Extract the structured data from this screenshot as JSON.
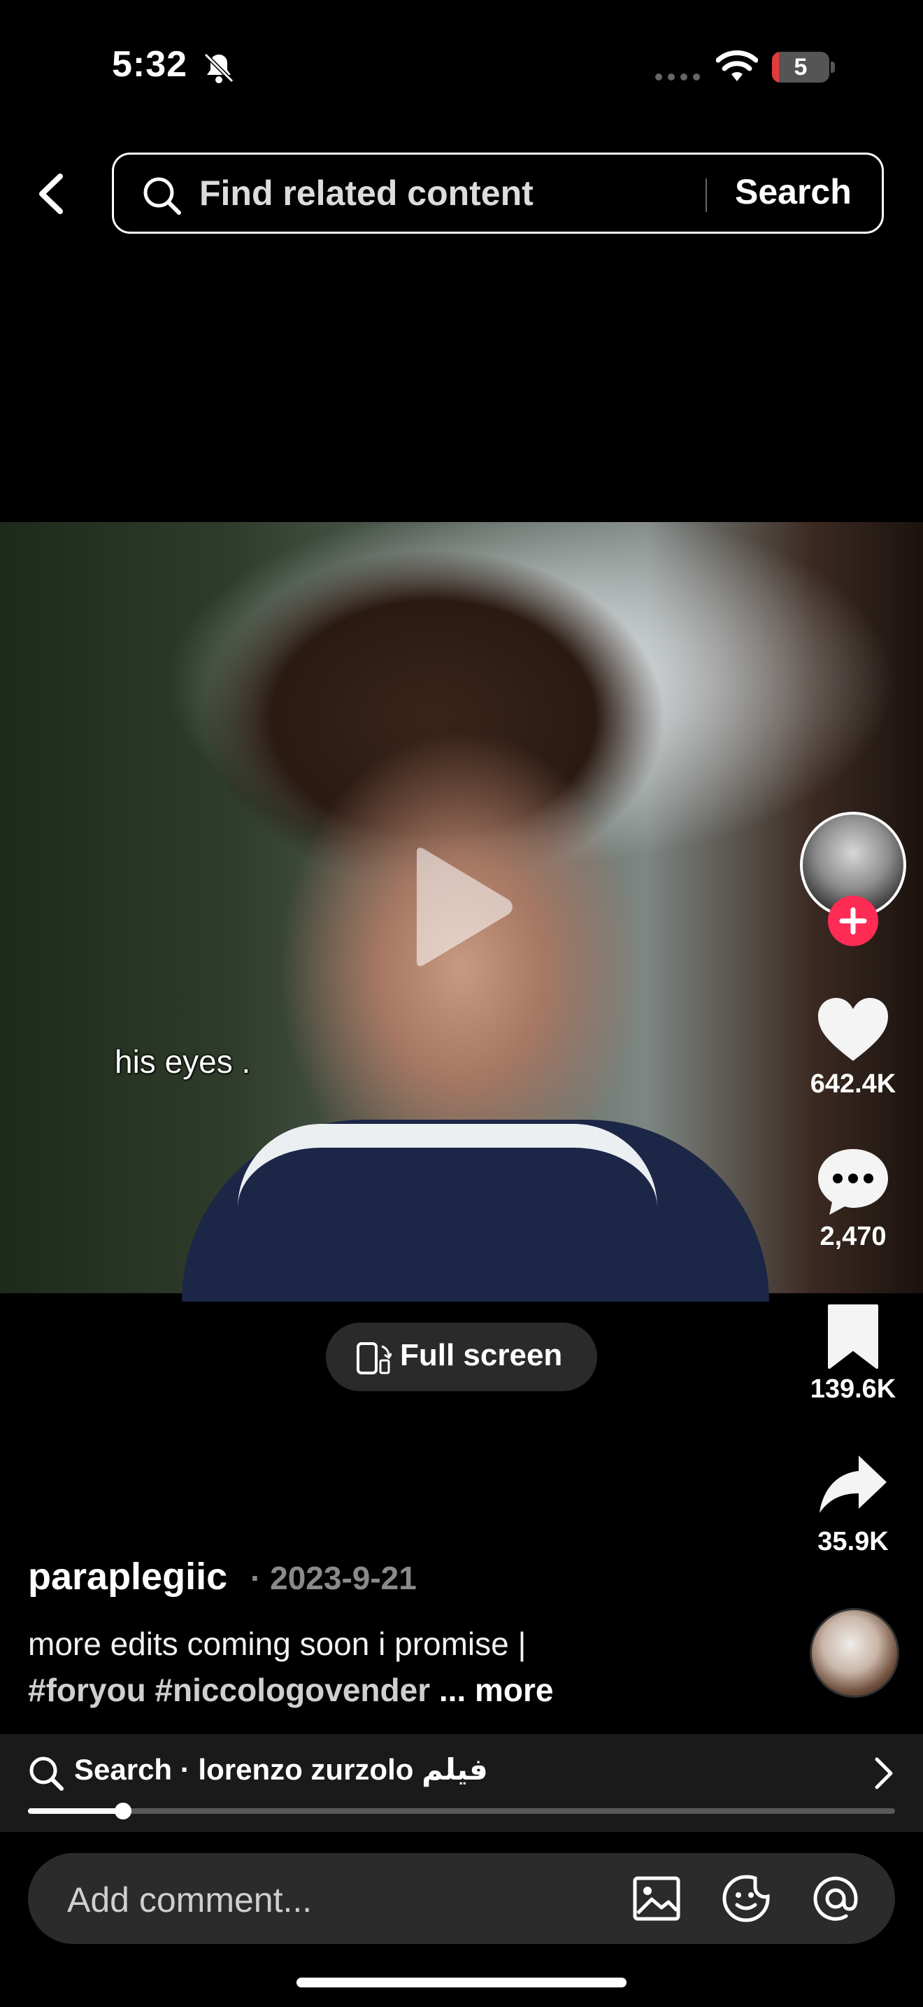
{
  "status_bar": {
    "time": "5:32",
    "battery_level": "5",
    "icons": [
      "bell-slash-icon",
      "cellular-dots-icon",
      "wifi-icon",
      "battery-icon"
    ]
  },
  "top_bar": {
    "search_placeholder": "Find related content",
    "search_button": "Search",
    "icons": [
      "back-chevron-icon",
      "search-icon"
    ]
  },
  "video": {
    "subtitle": "his eyes .",
    "state": "paused",
    "icons": [
      "play-icon"
    ]
  },
  "fullscreen_button": {
    "label": "Full screen",
    "icon": "rotate-phone-icon"
  },
  "action_rail": {
    "likes": "642.4K",
    "comments": "2,470",
    "saves": "139.6K",
    "shares": "35.9K",
    "icons": [
      "creator-avatar",
      "follow-plus-icon",
      "heart-icon",
      "comment-bubble-icon",
      "bookmark-icon",
      "share-arrow-icon",
      "music-disc-avatar"
    ]
  },
  "caption": {
    "author": "paraplegiic",
    "separator": " · ",
    "date": "2023-9-21",
    "line1": "more edits coming soon i promise |",
    "line2_hashtags": "#foryou #niccologovender",
    "line2_more": " ... more"
  },
  "related_search": {
    "text": "Search · lorenzo zurzolo فيلم",
    "icons": [
      "search-icon",
      "chevron-right-icon"
    ]
  },
  "playback_progress": 0.11,
  "comment_bar": {
    "placeholder": "Add comment...",
    "icons": [
      "image-icon",
      "sticker-icon",
      "mention-at-icon"
    ]
  },
  "colors": {
    "background": "#000000",
    "accent_follow": "#fe2c55",
    "strip_background": "#1a1a1a",
    "comment_bar": "#2b2b2b"
  }
}
